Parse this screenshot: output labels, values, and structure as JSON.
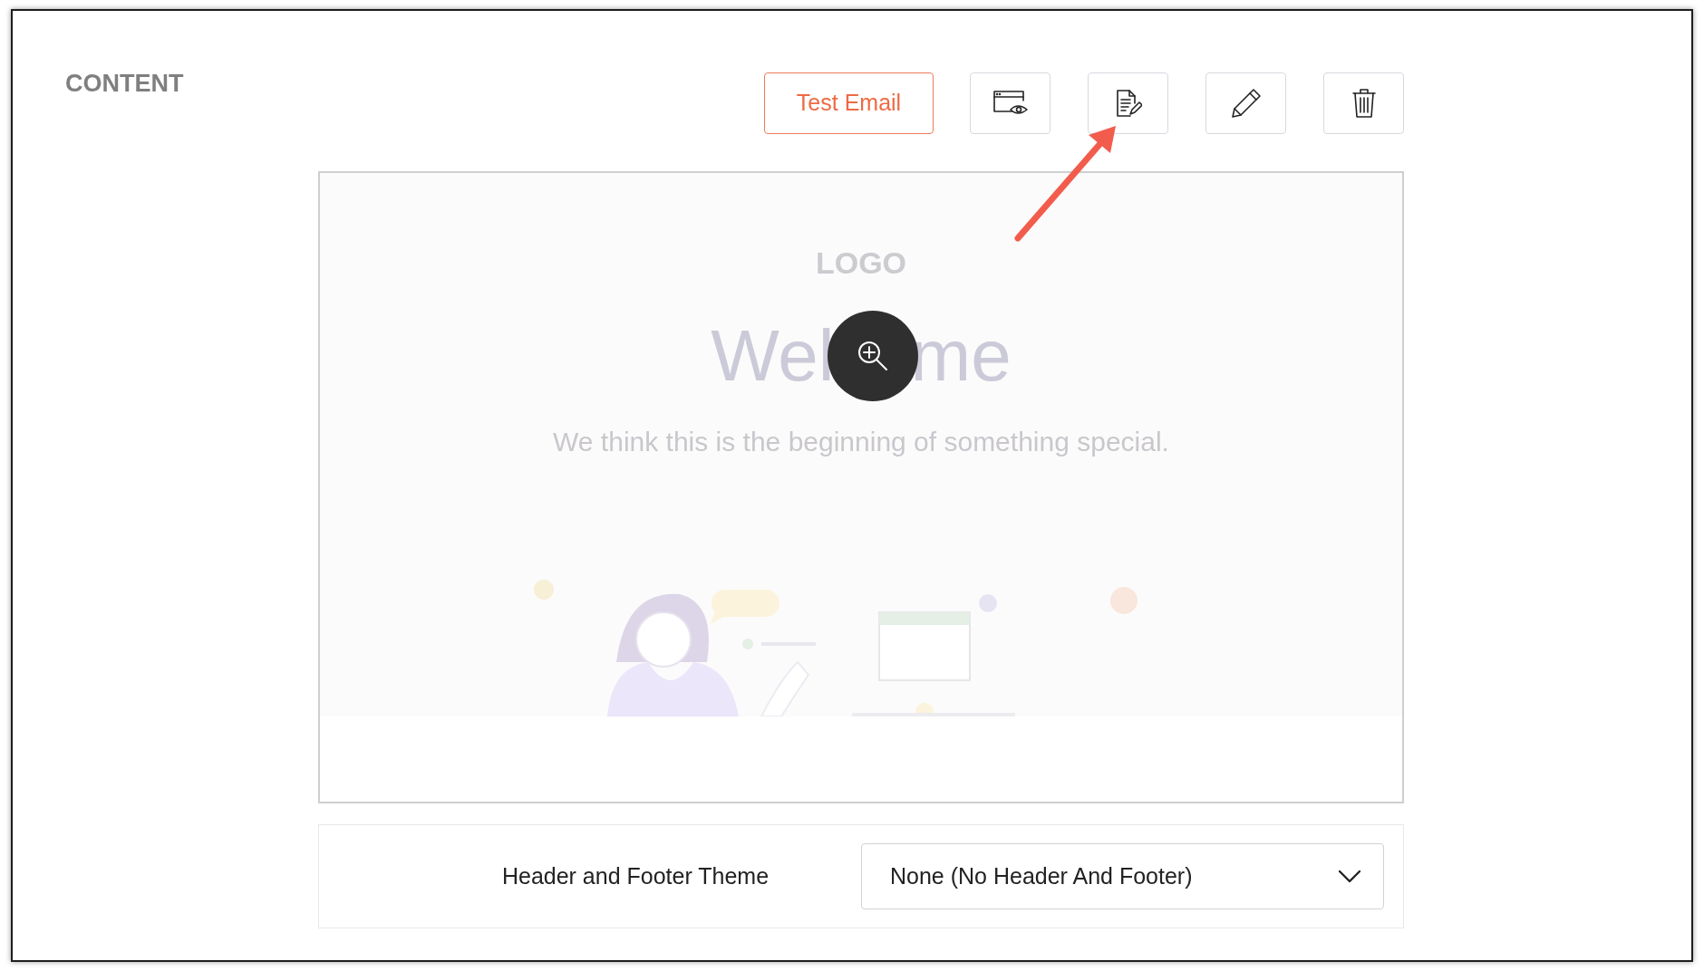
{
  "section_title": "CONTENT",
  "toolbar": {
    "buttons": [
      {
        "kind": "text",
        "label": "Test Email"
      },
      {
        "kind": "preview"
      },
      {
        "kind": "document"
      },
      {
        "kind": "edit"
      },
      {
        "kind": "delete"
      }
    ]
  },
  "preview": {
    "logo": "LOGO",
    "heading_parts": [
      "Wel",
      "me"
    ],
    "tagline": "We think this is the beginning of something special."
  },
  "theme_setting": {
    "label": "Header and Footer Theme",
    "value": "None (No Header And Footer)"
  }
}
